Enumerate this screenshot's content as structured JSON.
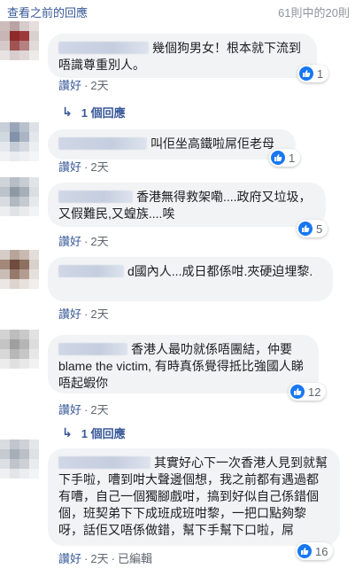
{
  "header": {
    "more_link": "查看之前的回應",
    "count": "61則中的20則"
  },
  "colors": {
    "link": "#385898",
    "bubble": "#f2f3f5",
    "like_blue": "#1877f2"
  },
  "comments": [
    {
      "text": "幾個狗男女！根本就下流到唔識尊重別人。",
      "like_label": "讚好",
      "time": "2天",
      "reactions": "1",
      "reply_label": "1 個回應",
      "edited": ""
    },
    {
      "text": "叫佢坐高鐵啦屌佢老母",
      "like_label": "讚好",
      "time": "2天",
      "reactions": "1",
      "reply_label": "",
      "edited": ""
    },
    {
      "text": "香港無得救架嘞....政府又垃圾，又假難民,又蝗族....唉",
      "like_label": "讚好",
      "time": "2天",
      "reactions": "5",
      "reply_label": "",
      "edited": ""
    },
    {
      "text": "d國內人...成日都係咁.夾硬迫埋黎.",
      "like_label": "讚好",
      "time": "2天",
      "reactions": "",
      "reply_label": "",
      "edited": ""
    },
    {
      "text": "香港人最叻就係唔團結，仲要 blame the victim, 有時真係覺得抵比強國人睇唔起蝦你",
      "like_label": "讚好",
      "time": "2天",
      "reactions": "12",
      "reply_label": "1 個回應",
      "edited": ""
    },
    {
      "text": "其實好心下一次香港人見到就幫下手啦，嘈到咁大聲邊個想，我之前都有遇過都有嘈，自己一個獨腳戲咁，搞到好似自己係錯個個，班契弟下下成班成班咁黎，一把口點夠黎呀，話佢又唔係做錯，幫下手幫下口啦，屌",
      "like_label": "讚好",
      "time": "2天",
      "reactions": "16",
      "reply_label": "",
      "edited": "已編輯"
    }
  ]
}
